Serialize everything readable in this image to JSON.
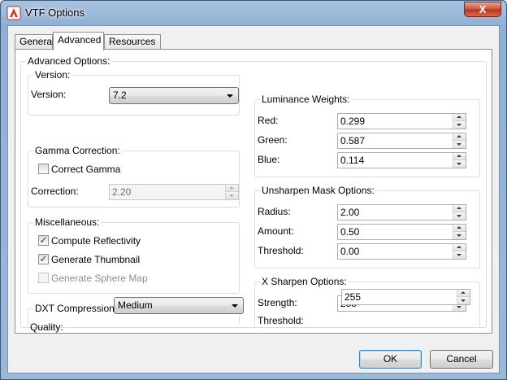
{
  "window": {
    "title": "VTF Options",
    "close_glyph": "X"
  },
  "tabs": [
    {
      "label": "General",
      "active": false
    },
    {
      "label": "Advanced",
      "active": true
    },
    {
      "label": "Resources",
      "active": false
    }
  ],
  "advanced": {
    "outer_label": "Advanced Options:",
    "version_group": {
      "label": "Version:",
      "field_label": "Version:",
      "value": "7.2"
    },
    "gamma_group": {
      "label": "Gamma Correction:",
      "correct_gamma_label": "Correct Gamma",
      "correct_gamma_checked": false,
      "correction_label": "Correction:",
      "correction_value": "2.20"
    },
    "misc_group": {
      "label": "Miscellaneous:",
      "compute_reflectivity_label": "Compute Reflectivity",
      "compute_reflectivity_checked": true,
      "generate_thumbnail_label": "Generate Thumbnail",
      "generate_thumbnail_checked": true,
      "generate_sphere_map_label": "Generate Sphere Map",
      "generate_sphere_map_checked": false
    },
    "dxt_group": {
      "label": "DXT Compression:",
      "quality_label": "Quality:",
      "quality_value": "Medium"
    },
    "luminance_group": {
      "label": "Luminance Weights:",
      "red_label": "Red:",
      "red_value": "0.299",
      "green_label": "Green:",
      "green_value": "0.587",
      "blue_label": "Blue:",
      "blue_value": "0.114"
    },
    "unsharpen_group": {
      "label": "Unsharpen Mask Options:",
      "radius_label": "Radius:",
      "radius_value": "2.00",
      "amount_label": "Amount:",
      "amount_value": "0.50",
      "threshold_label": "Threshold:",
      "threshold_value": "0.00"
    },
    "xsharpen_group": {
      "label": "X Sharpen Options:",
      "strength_label": "Strength:",
      "strength_value": "255",
      "threshold_label": "Threshold:",
      "threshold_value": "255"
    }
  },
  "footer": {
    "ok_label": "OK",
    "cancel_label": "Cancel"
  },
  "icons": {
    "check_glyph": "✓"
  },
  "colors": {
    "title_bar": "#9bb8d8",
    "close_button": "#c9513b",
    "default_button_border": "#3c7fb1"
  }
}
